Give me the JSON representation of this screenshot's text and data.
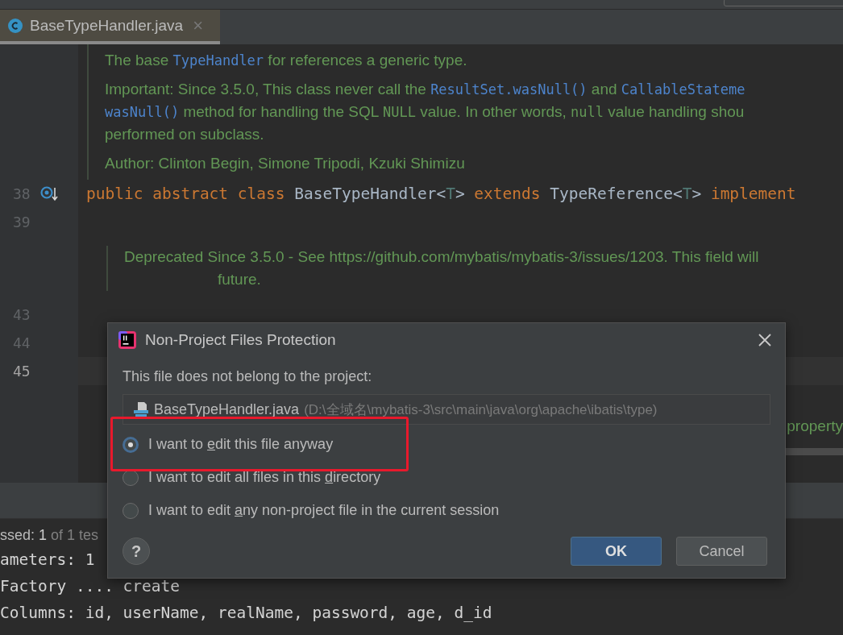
{
  "tab": {
    "label": "BaseTypeHandler.java",
    "close": "×",
    "selected": true
  },
  "editor": {
    "doc": [
      [
        [
          {
            "kind": "text",
            "text": "The base "
          },
          {
            "kind": "link",
            "text": "TypeHandler"
          },
          {
            "kind": "text",
            "text": " for references a generic type."
          }
        ]
      ],
      [
        [
          {
            "kind": "text",
            "text": "Important: Since 3.5.0, This class never call the "
          },
          {
            "kind": "link",
            "text": "ResultSet.wasNull()"
          },
          {
            "kind": "text",
            "text": " and "
          },
          {
            "kind": "link",
            "text": "CallableStateme"
          }
        ],
        [
          {
            "kind": "link",
            "text": "wasNull()"
          },
          {
            "kind": "text",
            "text": " method for handling the SQL "
          },
          {
            "kind": "code",
            "text": "NULL"
          },
          {
            "kind": "text",
            "text": " value. In other words, "
          },
          {
            "kind": "code",
            "text": "null"
          },
          {
            "kind": "text",
            "text": " value handling shou"
          }
        ],
        [
          {
            "kind": "text",
            "text": "performed on subclass."
          }
        ]
      ],
      [
        [
          {
            "kind": "text",
            "text": "Author: Clinton Begin, Simone Tripodi, Kzuki Shimizu"
          }
        ]
      ]
    ],
    "rows": [
      {
        "number": "38",
        "kind": "code",
        "current": false,
        "marker": true,
        "tokens": [
          {
            "kind": "keyword",
            "text": "public abstract class "
          },
          {
            "kind": "ident",
            "text": "BaseTypeHandler<"
          },
          {
            "kind": "param",
            "text": "T"
          },
          {
            "kind": "ident",
            "text": "> "
          },
          {
            "kind": "keyword",
            "text": "extends "
          },
          {
            "kind": "ident",
            "text": "TypeReference<"
          },
          {
            "kind": "param",
            "text": "T"
          },
          {
            "kind": "ident",
            "text": "> "
          },
          {
            "kind": "keyword",
            "text": "implement"
          }
        ]
      },
      {
        "number": "39",
        "kind": "code",
        "current": false,
        "marker": false,
        "tokens": []
      },
      {
        "kind": "note",
        "lines": [
          "Deprecated Since 3.5.0 - See https://github.com/mybatis/mybatis-3/issues/1203. This field will",
          "future."
        ]
      },
      {
        "number": "43",
        "kind": "code",
        "current": false,
        "marker": false,
        "tokens": []
      },
      {
        "number": "44",
        "kind": "code",
        "current": false,
        "marker": false,
        "tokens": []
      },
      {
        "number": "45",
        "kind": "code",
        "current": true,
        "marker": false,
        "tokens": []
      }
    ],
    "doc_fragment": "property"
  },
  "console": {
    "summary": {
      "prefix": "ssed:",
      "count": "1",
      "rest": "of 1 tes"
    },
    "lines": [
      "ameters: 1",
      "Factory .... create",
      "Columns: id, userName, realName, password, age, d_id"
    ]
  },
  "dialog": {
    "title": "Non-Project Files Protection",
    "message": "This file does not belong to the project:",
    "file": {
      "name": "BaseTypeHandler.java",
      "path": "(D:\\全域名\\mybatis-3\\src\\main\\java\\org\\apache\\ibatis\\type)"
    },
    "options": [
      {
        "before": "I want to ",
        "mnemonic": "e",
        "after": "dit this file anyway",
        "selected": true
      },
      {
        "before": "I want to edit all files in this ",
        "mnemonic": "d",
        "after": "irectory",
        "selected": false
      },
      {
        "before": "I want to edit ",
        "mnemonic": "a",
        "after": "ny non-project file in the current session",
        "selected": false
      }
    ],
    "help": "?",
    "buttons": [
      {
        "label": "OK",
        "default": true
      },
      {
        "label": "Cancel",
        "default": false
      }
    ]
  }
}
